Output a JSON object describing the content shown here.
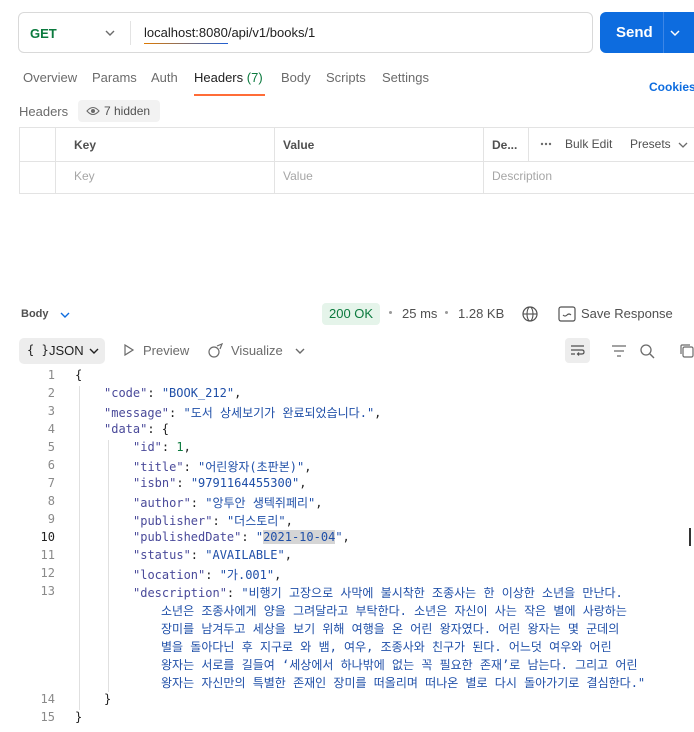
{
  "request": {
    "method": "GET",
    "url": "localhost:8080/api/v1/books/1",
    "send_label": "Send"
  },
  "tabs": {
    "overview": "Overview",
    "params": "Params",
    "auth": "Auth",
    "headers": "Headers",
    "headers_count": "(7)",
    "body": "Body",
    "scripts": "Scripts",
    "settings": "Settings",
    "cookies": "Cookies"
  },
  "headers": {
    "title": "Headers",
    "hidden": "7 hidden",
    "col_key": "Key",
    "col_value": "Value",
    "col_desc": "De...",
    "bulk_edit": "Bulk Edit",
    "presets": "Presets",
    "ph_key": "Key",
    "ph_value": "Value",
    "ph_desc": "Description"
  },
  "response": {
    "body_label": "Body",
    "status": "200 OK",
    "time": "25 ms",
    "size": "1.28 KB",
    "save": "Save Response"
  },
  "format": {
    "json": "JSON",
    "json_brace": "{ }",
    "preview": "Preview",
    "visualize": "Visualize"
  },
  "code": {
    "line_numbers": [
      "1",
      "2",
      "3",
      "4",
      "5",
      "6",
      "7",
      "8",
      "9",
      "10",
      "11",
      "12",
      "13",
      "14",
      "15"
    ],
    "code_key": "\"code\"",
    "code_val": "\"BOOK_212\"",
    "message_key": "\"message\"",
    "message_val": "\"도서 상세보기가 완료되었습니다.\"",
    "data_key": "\"data\"",
    "id_key": "\"id\"",
    "id_val": "1",
    "title_key": "\"title\"",
    "title_val": "\"어린왕자(초판본)\"",
    "isbn_key": "\"isbn\"",
    "isbn_val": "\"9791164455300\"",
    "author_key": "\"author\"",
    "author_val": "\"앙투안 생텍쥐페리\"",
    "publisher_key": "\"publisher\"",
    "publisher_val": "\"더스토리\"",
    "published_key": "\"publishedDate\"",
    "published_val": "2021-10-04",
    "status_key": "\"status\"",
    "status_val": "\"AVAILABLE\"",
    "location_key": "\"location\"",
    "location_val": "\"가.001\"",
    "desc_key": "\"description\"",
    "desc_lines": [
      "\"비행기 고장으로 사막에 불시착한 조종사는 한 이상한 소년을 만난다.",
      "소년은 조종사에게 양을 그려달라고 부탁한다. 소년은 자신이 사는 작은 별에 사랑하는",
      "장미를 남겨두고 세상을 보기 위해 여행을 온 어린 왕자였다. 어린 왕자는 몇 군데의",
      "별을 돌아다닌 후 지구로 와 뱀, 여우, 조종사와 친구가 된다. 어느덧 여우와 어린",
      "왕자는 서로를 길들여 ‘세상에서 하나밖에 없는 꼭 필요한 존재’로 남는다. 그리고 어린",
      "왕자는 자신만의 특별한 존재인 장미를 떠올리며 떠나온 별로 다시 돌아가기로 결심한다.\""
    ]
  }
}
